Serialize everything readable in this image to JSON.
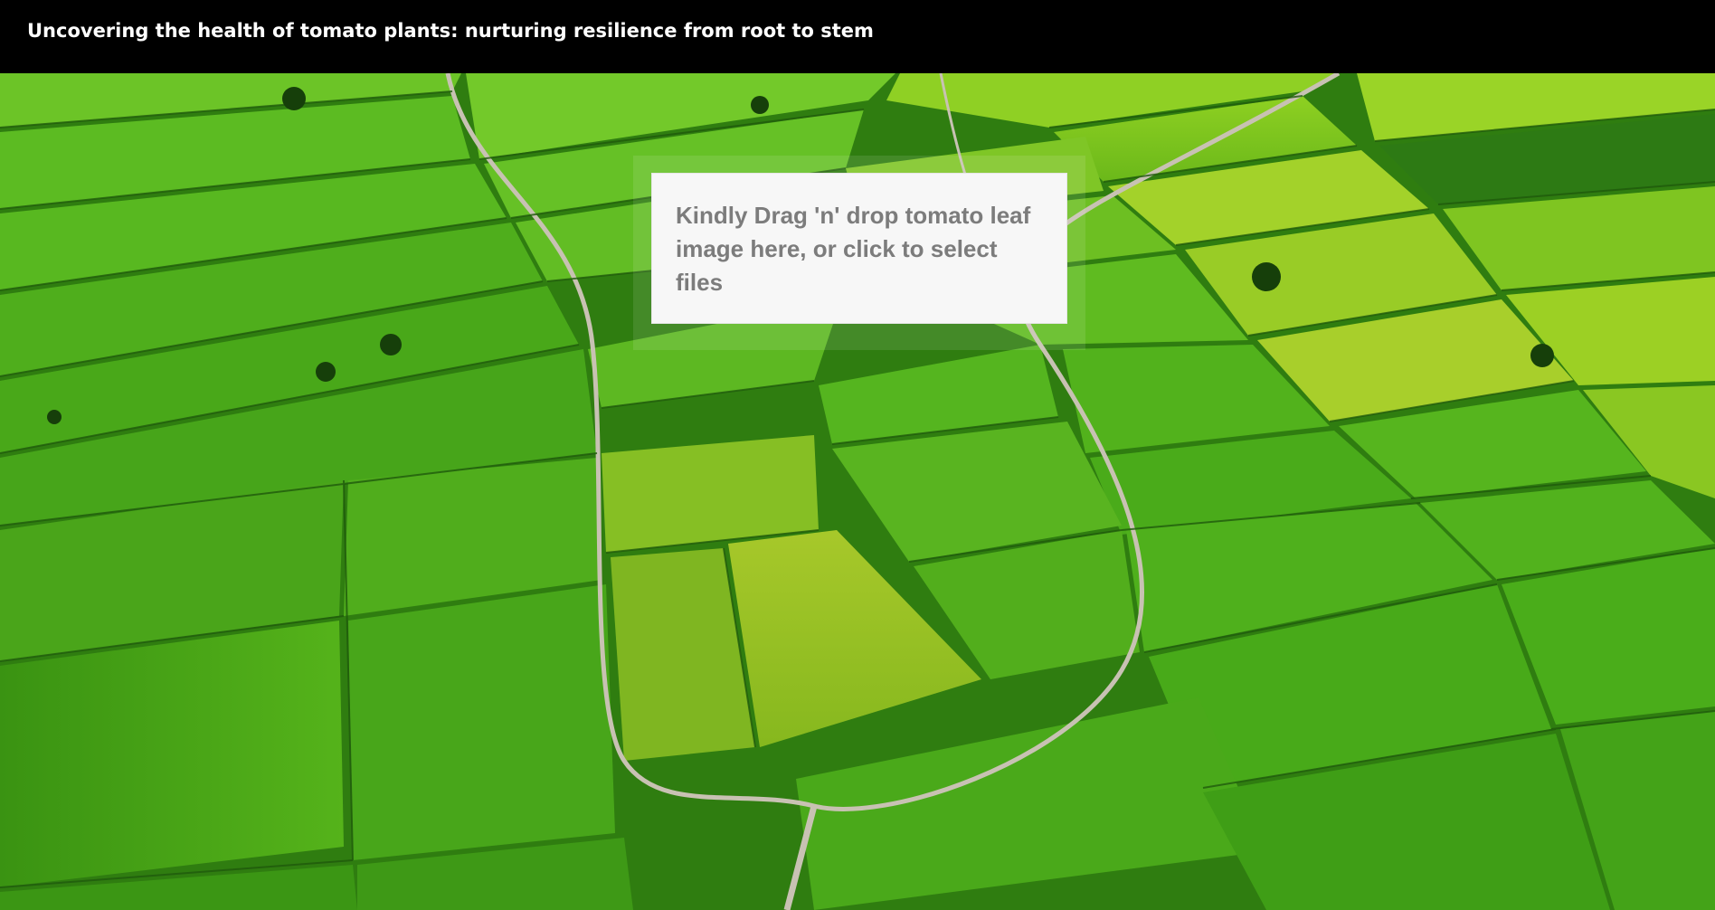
{
  "header": {
    "title": "Uncovering the health of tomato plants: nurturing resilience from root to stem"
  },
  "upload": {
    "prompt": "Kindly Drag 'n' drop tomato leaf image here, or click to select files"
  },
  "colors": {
    "header_bg": "#000000",
    "header_text": "#ffffff",
    "dropzone_bg": "#f7f7f7",
    "dropzone_text": "#7c7c7c"
  }
}
